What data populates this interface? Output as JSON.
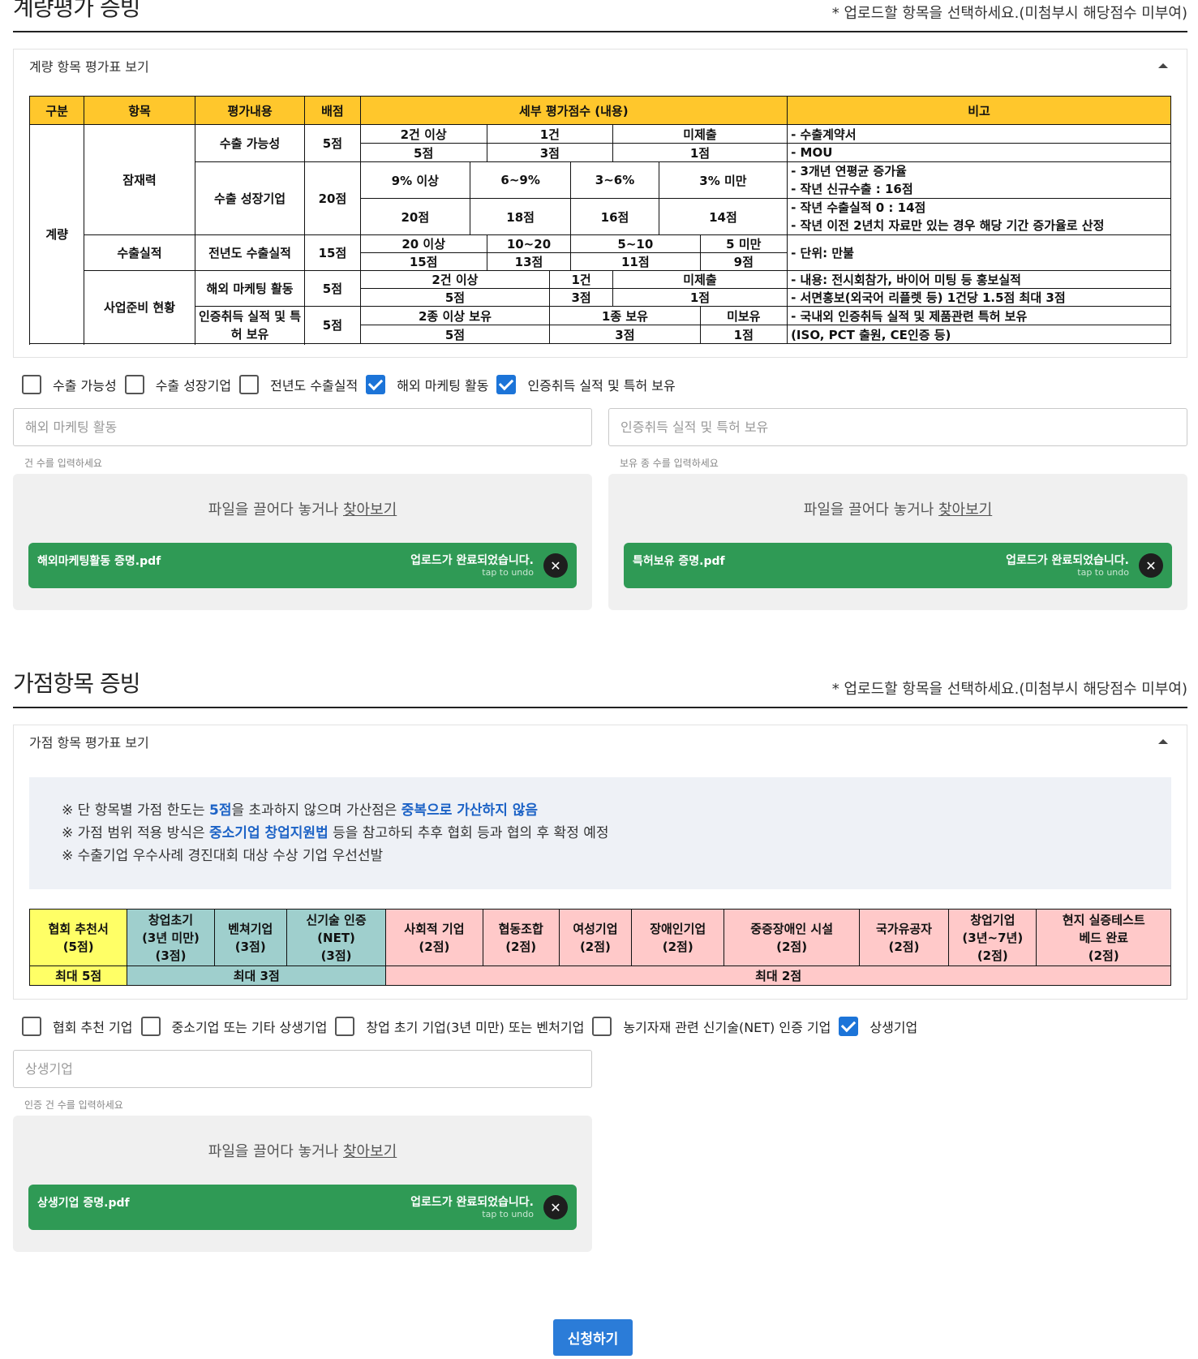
{
  "quant": {
    "title": "계량평가 증빙",
    "note": "* 업로드할 항목을 선택하세요.(미첨부시 해당점수 미부여)",
    "panel_title": "계량 항목 평가표 보기",
    "table": {
      "headers": [
        "구분",
        "항목",
        "평가내용",
        "배점",
        "세부 평가점수 (내용)",
        "비고"
      ],
      "group": "계량",
      "cat1": "잠재력",
      "cat2": "수출실적",
      "cat3": "사업준비 현황",
      "r1": {
        "content": "수출 가능성",
        "points": "5점",
        "c": [
          "2건 이상",
          "1건",
          "미제출"
        ],
        "s": [
          "5점",
          "3점",
          "1점"
        ],
        "note1": "- 수출계약서",
        "note2": "- MOU"
      },
      "r2": {
        "content": "수출 성장기업",
        "points": "20점",
        "c": [
          "9% 이상",
          "6~9%",
          "3~6%",
          "3% 미만"
        ],
        "s": [
          "20점",
          "18점",
          "16점",
          "14점"
        ],
        "note1": "- 3개년 연평균 증가율",
        "note2": "- 작년 신규수출 : 16점",
        "note3": "- 작년 수출실적 0 : 14점",
        "note4": "- 작년 이전 2년치 자료만 있는 경우 해당 기간 증가율로 산정"
      },
      "r3": {
        "content": "전년도 수출실적",
        "points": "15점",
        "c": [
          "20 이상",
          "10~20",
          "5~10",
          "5 미만"
        ],
        "s": [
          "15점",
          "13점",
          "11점",
          "9점"
        ],
        "note1": "- 단위: 만불"
      },
      "r4": {
        "content": "해외 마케팅 활동",
        "points": "5점",
        "c": [
          "2건 이상",
          "1건",
          "미제출"
        ],
        "s": [
          "5점",
          "3점",
          "1점"
        ],
        "note1": "- 내용: 전시회참가, 바이어 미팅 등 홍보실적",
        "note2": "- 서면홍보(외국어 리플렛 등) 1건당 1.5점 최대 3점"
      },
      "r5": {
        "content": "인증취득 실적 및 특허 보유",
        "points": "5점",
        "c": [
          "2종 이상 보유",
          "1종 보유",
          "미보유"
        ],
        "s": [
          "5점",
          "3점",
          "1점"
        ],
        "note1": "- 국내외 인증취득 실적 및 제품관련 특허 보유",
        "note2": "(ISO, PCT 출원, CE인증 등)"
      }
    },
    "checks": [
      {
        "label": "수출 가능성",
        "checked": false
      },
      {
        "label": "수출 성장기업",
        "checked": false
      },
      {
        "label": "전년도 수출실적",
        "checked": false
      },
      {
        "label": "해외 마케팅 활동",
        "checked": true
      },
      {
        "label": "인증취득 실적 및 특허 보유",
        "checked": true
      }
    ],
    "uploads": [
      {
        "placeholder": "해외 마케팅 활동",
        "help": "건 수를 입력하세요",
        "drop_text": "파일을 끌어다 놓거나 ",
        "browse": "찾아보기",
        "file": "해외마케팅활동 증명.pdf",
        "status": "업로드가 완료되었습니다.",
        "undo": "tap to undo"
      },
      {
        "placeholder": "인증취득 실적 및 특허 보유",
        "help": "보유 종 수를 입력하세요",
        "drop_text": "파일을 끌어다 놓거나 ",
        "browse": "찾아보기",
        "file": "특허보유 증명.pdf",
        "status": "업로드가 완료되었습니다.",
        "undo": "tap to undo"
      }
    ]
  },
  "bonus": {
    "title": "가점항목 증빙",
    "note": "* 업로드할 항목을 선택하세요.(미첨부시 해당점수 미부여)",
    "panel_title": "가점 항목 평가표 보기",
    "notice": {
      "l1a": "※ 단 항목별 가점 한도는 ",
      "l1b": "5점",
      "l1c": "을 초과하지 않으며 가산점은 ",
      "l1d": "중복으로 가산하지 않음",
      "l2a": "※ 가점 범위 적용 방식은 ",
      "l2b": "중소기업 창업지원법",
      "l2c": " 등을 참고하되 추후 협회 등과 협의 후 확정 예정",
      "l3": "※ 수출기업 우수사례 경진대회 대상 수상 기업 우선선발"
    },
    "table": {
      "cells": [
        {
          "l1": "협회 추천서",
          "l2": "(5점)",
          "l3": ""
        },
        {
          "l1": "창업초기",
          "l2": "(3년 미만)",
          "l3": "(3점)"
        },
        {
          "l1": "벤쳐기업",
          "l2": "(3점)",
          "l3": ""
        },
        {
          "l1": "신기술 인증",
          "l2": "(NET)",
          "l3": "(3점)"
        },
        {
          "l1": "사회적 기업",
          "l2": "(2점)",
          "l3": ""
        },
        {
          "l1": "협동조합",
          "l2": "(2점)",
          "l3": ""
        },
        {
          "l1": "여성기업",
          "l2": "(2점)",
          "l3": ""
        },
        {
          "l1": "장애인기업",
          "l2": "(2점)",
          "l3": ""
        },
        {
          "l1": "중증장애인 시설",
          "l2": "(2점)",
          "l3": ""
        },
        {
          "l1": "국가유공자",
          "l2": "(2점)",
          "l3": ""
        },
        {
          "l1": "창업기업",
          "l2": "(3년~7년)",
          "l3": "(2점)"
        },
        {
          "l1": "현지 실증테스트",
          "l2": "베드 완료",
          "l3": "(2점)"
        }
      ],
      "max": [
        "최대 5점",
        "최대 3점",
        "최대 2점"
      ]
    },
    "checks": [
      {
        "label": "협회 추천 기업",
        "checked": false
      },
      {
        "label": "중소기업 또는 기타 상생기업",
        "checked": false
      },
      {
        "label": "창업 초기 기업(3년 미만) 또는 벤처기업",
        "checked": false
      },
      {
        "label": "농기자재 관련 신기술(NET) 인증 기업",
        "checked": false
      },
      {
        "label": "상생기업",
        "checked": true
      }
    ],
    "upload": {
      "placeholder": "상생기업",
      "help": "인증 건 수를 입력하세요",
      "drop_text": "파일을 끌어다 놓거나 ",
      "browse": "찾아보기",
      "file": "상생기업 증명.pdf",
      "status": "업로드가 완료되었습니다.",
      "undo": "tap to undo"
    }
  },
  "submit_label": "신청하기",
  "colors": {
    "header": "#ffc72c",
    "file_bg": "#2f9a55",
    "checked": "#1c74d8",
    "yellow": "#ffff66",
    "teal": "#9fcfcd",
    "pink": "#ffc9c9",
    "submit": "#2b7cd8"
  }
}
